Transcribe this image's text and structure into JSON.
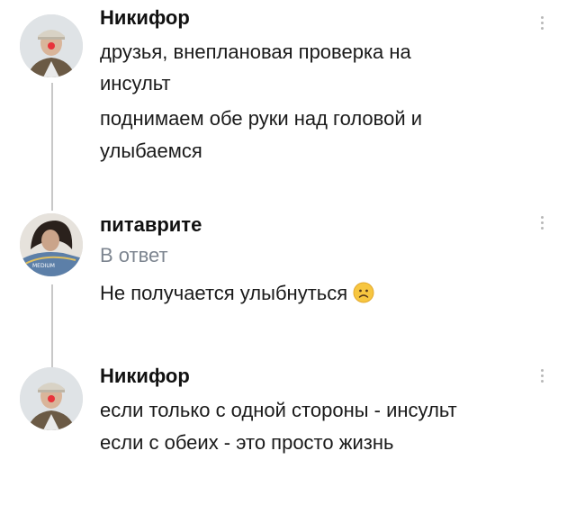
{
  "comments": [
    {
      "author": "Никифор",
      "lines": [
        "друзья, внеплановая проверка на",
        "инсульт",
        "поднимаем обе руки над головой и",
        "улыбаемся"
      ],
      "avatar_icon": "man-with-clown-nose-avatar"
    },
    {
      "author": "питаврите",
      "reply_label": "В ответ",
      "lines": [
        "Не получается улыбнуться"
      ],
      "emoji": "sad-face-emoji",
      "avatar_icon": "girl-with-cap-avatar"
    },
    {
      "author": "Никифор",
      "lines": [
        "если только с одной стороны - инсульт",
        "если с обеих - это просто жизнь"
      ],
      "avatar_icon": "man-with-clown-nose-avatar"
    }
  ],
  "colors": {
    "text": "#1a1a1a",
    "secondary": "#7d8590",
    "thread_line": "#c8c8c8",
    "menu_dots": "#b8b8b8",
    "emoji_face": "#f7c640"
  }
}
